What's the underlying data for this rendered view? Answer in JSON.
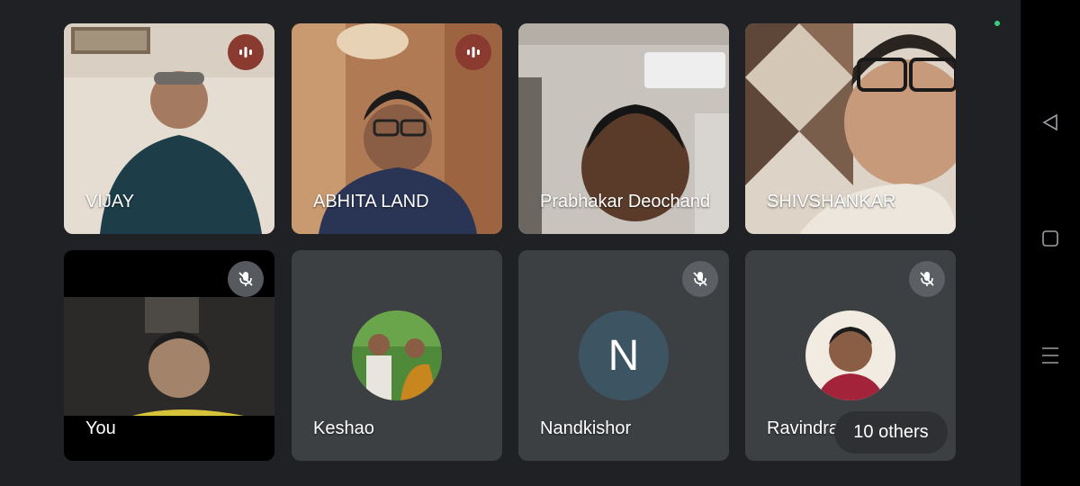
{
  "participants": [
    {
      "name": "VIJAY",
      "status": "speaking"
    },
    {
      "name": "ABHITA LAND",
      "status": "speaking"
    },
    {
      "name": "Prabhakar Deochand",
      "status": "video"
    },
    {
      "name": "SHIVSHANKAR",
      "status": "video"
    },
    {
      "name": "You",
      "status": "muted"
    },
    {
      "name": "Keshao",
      "status": "muted"
    },
    {
      "name": "Nandkishor",
      "status": "muted",
      "avatar_letter": "N"
    },
    {
      "name": "Ravindra",
      "status": "muted"
    }
  ],
  "others_chip": {
    "label": "10 others"
  },
  "icons": {
    "speaking": "audio-level-icon",
    "muted": "mic-off-icon",
    "nav": [
      "back-icon",
      "home-icon",
      "recents-icon"
    ]
  },
  "colors": {
    "background": "#202124",
    "tile": "#3c4043",
    "speaking_accent": "#8a3a2f",
    "avatar_n": "#3d5463",
    "status_dot": "#34d07b"
  }
}
